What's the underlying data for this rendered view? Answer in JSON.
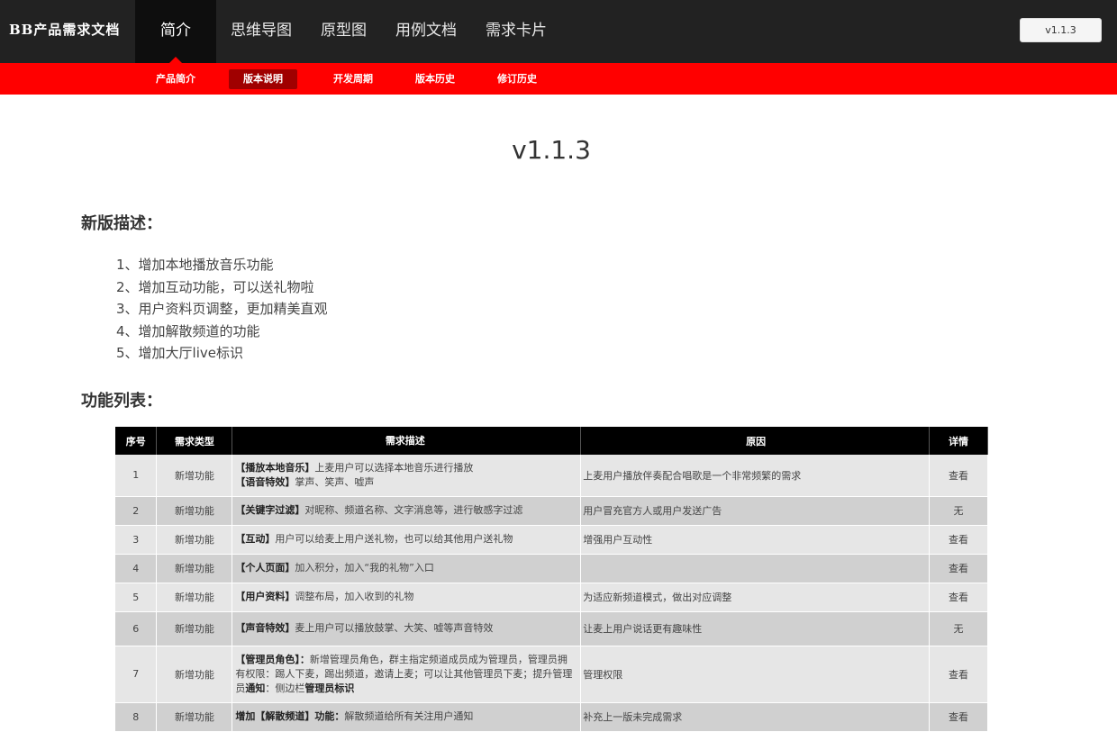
{
  "header": {
    "brand": "BB产品需求文档",
    "nav": [
      {
        "label": "简介",
        "active": true
      },
      {
        "label": "思维导图",
        "active": false
      },
      {
        "label": "原型图",
        "active": false
      },
      {
        "label": "用例文档",
        "active": false
      },
      {
        "label": "需求卡片",
        "active": false
      }
    ],
    "version_button": "v1.1.3"
  },
  "subnav": [
    {
      "label": "产品简介",
      "active": false
    },
    {
      "label": "版本说明",
      "active": true
    },
    {
      "label": "开发周期",
      "active": false
    },
    {
      "label": "版本历史",
      "active": false
    },
    {
      "label": "修订历史",
      "active": false
    }
  ],
  "main": {
    "title": "v1.1.3",
    "new_desc_heading": "新版描述：",
    "new_desc_items": [
      "1、增加本地播放音乐功能",
      "2、增加互动功能，可以送礼物啦",
      "3、用户资料页调整，更加精美直观",
      "4、增加解散频道的功能",
      "5、增加大厅live标识"
    ],
    "feature_heading": "功能列表："
  },
  "table": {
    "headers": [
      "序号",
      "需求类型",
      "需求描述",
      "原因",
      "详情"
    ],
    "rows": [
      {
        "idx": "1",
        "type": "新增功能",
        "desc": [
          [
            "b",
            "【播放本地音乐】"
          ],
          [
            "t",
            "上麦用户可以选择本地音乐进行播放"
          ],
          [
            "br",
            ""
          ],
          [
            "b",
            "【语音特效】"
          ],
          [
            "t",
            "掌声、笑声、嘘声"
          ]
        ],
        "reason": "上麦用户播放伴奏配合唱歌是一个非常频繁的需求",
        "detail": "查看",
        "height": 46
      },
      {
        "idx": "2",
        "type": "新增功能",
        "desc": [
          [
            "b",
            "【关键字过滤】"
          ],
          [
            "t",
            "对昵称、频道名称、文字消息等，进行敏感字过滤"
          ]
        ],
        "reason": "用户冒充官方人或用户发送广告",
        "detail": "无",
        "height": 32
      },
      {
        "idx": "3",
        "type": "新增功能",
        "desc": [
          [
            "b",
            "【互动】"
          ],
          [
            "t",
            "用户可以给麦上用户送礼物，也可以给其他用户送礼物"
          ]
        ],
        "reason": "增强用户互动性",
        "detail": "查看",
        "height": 32
      },
      {
        "idx": "4",
        "type": "新增功能",
        "desc": [
          [
            "b",
            "【个人页面】"
          ],
          [
            "t",
            "加入积分，加入“我的礼物”入口"
          ]
        ],
        "reason": "",
        "detail": "查看",
        "height": 32
      },
      {
        "idx": "5",
        "type": "新增功能",
        "desc": [
          [
            "b",
            "【用户资料】"
          ],
          [
            "t",
            "调整布局，加入收到的礼物"
          ]
        ],
        "reason": "为适应新频道模式，做出对应调整",
        "detail": "查看",
        "height": 32
      },
      {
        "idx": "6",
        "type": "新增功能",
        "desc": [
          [
            "b",
            "【声音特效】"
          ],
          [
            "t",
            "麦上用户可以播放鼓掌、大笑、嘘等声音特效"
          ]
        ],
        "reason": "让麦上用户说话更有趣味性",
        "detail": "无",
        "height": 38
      },
      {
        "idx": "7",
        "type": "新增功能",
        "desc": [
          [
            "b",
            "【管理员角色】："
          ],
          [
            "t",
            "新增管理员角色，群主指定频道成员成为管理员，管理员拥有权限：踢人下麦，踢出频道，邀请上麦；可以让其他管理员下麦；提升管理员"
          ],
          [
            "b",
            "通知"
          ],
          [
            "t",
            "：侧边栏"
          ],
          [
            "b",
            "管理员标识"
          ]
        ],
        "reason": "管理权限",
        "detail": "查看",
        "height": 63
      },
      {
        "idx": "8",
        "type": "新增功能",
        "desc": [
          [
            "b",
            "增加【解散频道】功能："
          ],
          [
            "t",
            "解散频道给所有关注用户通知"
          ]
        ],
        "reason": "补充上一版未完成需求",
        "detail": "查看",
        "height": 32
      }
    ]
  }
}
